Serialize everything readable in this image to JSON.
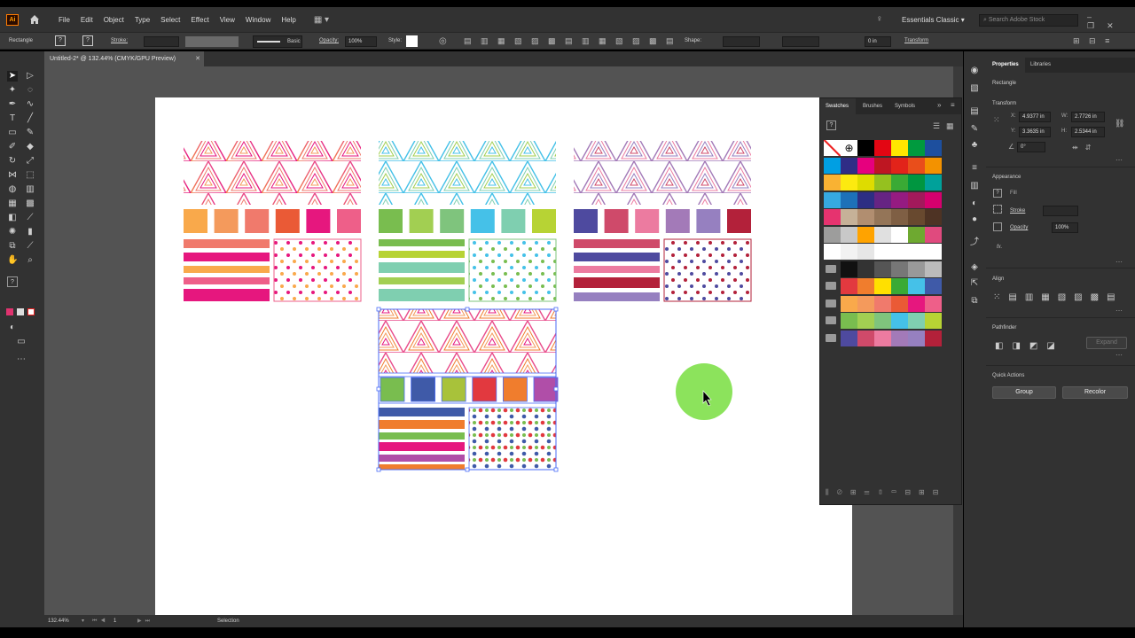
{
  "app": {
    "logo": "Ai"
  },
  "menu": {
    "items": [
      "File",
      "Edit",
      "Object",
      "Type",
      "Select",
      "Effect",
      "View",
      "Window",
      "Help"
    ],
    "workspace": "Essentials Classic",
    "search_placeholder": "Search Adobe Stock"
  },
  "control_bar": {
    "object_type": "Rectangle",
    "stroke_label": "Stroke:",
    "brush_label": "Basic",
    "opacity_label": "Opacity:",
    "opacity_value": "100%",
    "style_label": "Style:",
    "shape_label": "Shape:",
    "angle_value": "0 in",
    "transform_label": "Transform"
  },
  "document": {
    "tab_title": "Untitled-2* @ 132.44% (CMYK/GPU Preview)"
  },
  "status": {
    "zoom": "132.44%",
    "artboard": "1",
    "tool": "Selection"
  },
  "swatches_panel": {
    "tabs": [
      "Swatches",
      "Brushes",
      "Symbols"
    ],
    "help": "?"
  },
  "properties": {
    "tabs": [
      "Properties",
      "Libraries"
    ],
    "selection": "Rectangle",
    "transform": {
      "title": "Transform",
      "x_label": "X:",
      "x": "4.9377 in",
      "y_label": "Y:",
      "y": "3.3635 in",
      "w_label": "W:",
      "w": "2.7726 in",
      "h_label": "H:",
      "h": "2.5344 in",
      "angle": "0°"
    },
    "appearance": {
      "title": "Appearance",
      "fill_label": "Fill",
      "stroke_label": "Stroke",
      "opacity_label": "Opacity",
      "opacity_value": "100%",
      "fx": "fx."
    },
    "align": {
      "title": "Align"
    },
    "pathfinder": {
      "title": "Pathfinder",
      "expand": "Expand"
    },
    "quick_actions": {
      "title": "Quick Actions",
      "group": "Group",
      "recolor": "Recolor"
    }
  },
  "colors": {
    "swatch_rows": [
      [
        "#ffffff",
        "#ffffff",
        "#000000",
        "#e30613",
        "#ffe600",
        "#009a3e",
        "#1d4f9e"
      ],
      [
        "#009fe3",
        "#2f2d86",
        "#e6007e",
        "#be1622",
        "#e2231a",
        "#e94e1b",
        "#f39200"
      ],
      [
        "#f9b233",
        "#fcea10",
        "#dedc00",
        "#95c11f",
        "#3aaa35",
        "#009640",
        "#00a19a"
      ],
      [
        "#36a9e1",
        "#1d71b8",
        "#2d2e83",
        "#662483",
        "#951b81",
        "#a3195b",
        "#d6006e"
      ],
      [
        "#e6336f",
        "#c6b198",
        "#b18e70",
        "#947558",
        "#7f5f44",
        "#68492f",
        "#4e3324"
      ],
      [
        "#9d9d9c",
        "#c8c8c8",
        "#ffa300",
        "#e0e0e0",
        "#ffffff",
        "#6ea930",
        "#e04a7e"
      ]
    ],
    "palette_warm": [
      "#f9a94b",
      "#f49a5c",
      "#f07a6c",
      "#ea5a36",
      "#e6177e",
      "#ee5f89"
    ],
    "palette_green": [
      "#79bd4f",
      "#a2cf52",
      "#7fc47d",
      "#45c1e8",
      "#7fcfb0",
      "#b7d334"
    ],
    "palette_purple": [
      "#4e4a9f",
      "#cf4a6a",
      "#ec7ba0",
      "#a37ab8",
      "#9680c0",
      "#b3213a"
    ],
    "palette_mixed": [
      "#79bd4f",
      "#3f5aa8",
      "#a8c23a",
      "#e2393f",
      "#f07d2d",
      "#b04ea8"
    ]
  }
}
